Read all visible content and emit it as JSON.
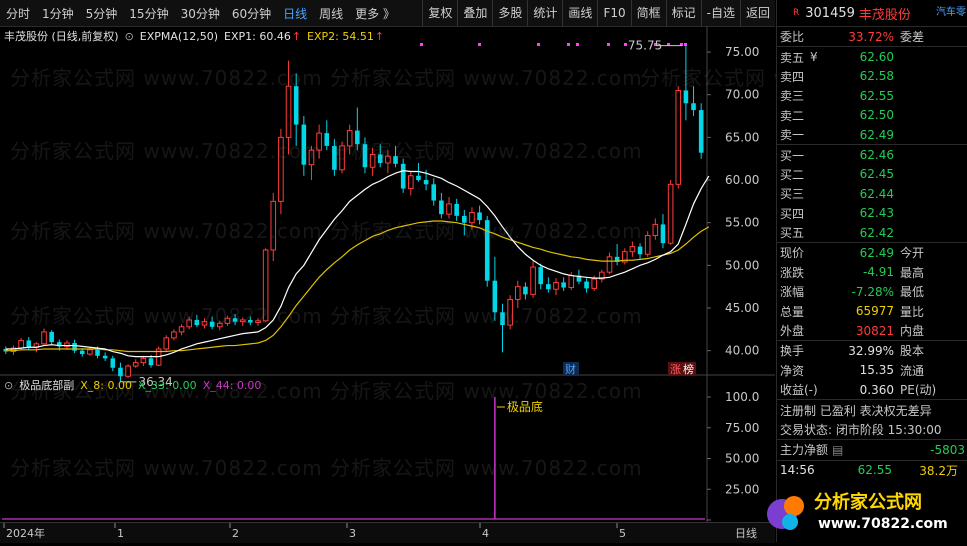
{
  "toolbar": {
    "periods": [
      "分时",
      "1分钟",
      "5分钟",
      "15分钟",
      "30分钟",
      "60分钟",
      "日线",
      "周线",
      "更多 》"
    ],
    "active_period": "日线",
    "buttons": [
      "复权",
      "叠加",
      "多股",
      "统计",
      "画线",
      "F10",
      "简框",
      "标记",
      "-自选",
      "返回"
    ]
  },
  "main_legend": {
    "title": "丰茂股份 (日线,前复权)",
    "indicator": "EXPMA(12,50)",
    "exp1_label": "EXP1: 60.46",
    "exp1_arrow": "↑",
    "exp2_label": "EXP2: 54.51",
    "exp2_arrow": "↑"
  },
  "sub_legend": {
    "title": "极品底部副",
    "x8": "X_8: 0.00",
    "x33": "X_33: 0.00",
    "x44": "X_44: 0.00"
  },
  "annotations": {
    "high": "75.75",
    "low": "36.34",
    "signal": "极品底",
    "finance_tag": "财",
    "limit_tag": "涨",
    "limit_tag2": "榜"
  },
  "watermark": "分析家公式网 www.70822.com",
  "chart_data": [
    {
      "type": "candlestick",
      "title": "丰茂股份 (日线,前复权)",
      "x_axis_labels": [
        "2024年",
        "1",
        "2",
        "3",
        "4",
        "5"
      ],
      "y_ticks": [
        40,
        45,
        50,
        55,
        60,
        65,
        70,
        75
      ],
      "ylim": [
        37.5,
        77
      ],
      "series": [
        {
          "name": "EXP1",
          "color": "#ffffff"
        },
        {
          "name": "EXP2",
          "color": "#e0c000"
        }
      ],
      "exp1_last": 60.46,
      "exp2_last": 54.51,
      "high_point": 75.75,
      "low_point": 36.34,
      "candles": [
        [
          40.2,
          40.5,
          39.6,
          39.9
        ],
        [
          39.9,
          40.6,
          39.5,
          40.3
        ],
        [
          40.3,
          41.5,
          40.0,
          41.2
        ],
        [
          41.2,
          41.6,
          40.1,
          40.4
        ],
        [
          40.4,
          41.0,
          39.8,
          40.8
        ],
        [
          40.8,
          42.6,
          40.6,
          42.2
        ],
        [
          42.2,
          42.4,
          40.6,
          41.0
        ],
        [
          41.0,
          41.3,
          40.0,
          40.5
        ],
        [
          40.5,
          41.2,
          40.1,
          40.9
        ],
        [
          40.9,
          41.3,
          39.7,
          40.0
        ],
        [
          40.0,
          40.3,
          39.3,
          39.6
        ],
        [
          39.6,
          40.4,
          39.4,
          40.1
        ],
        [
          40.1,
          40.5,
          39.1,
          39.4
        ],
        [
          39.4,
          39.8,
          38.8,
          39.1
        ],
        [
          39.1,
          39.4,
          37.6,
          38.0
        ],
        [
          38.0,
          38.6,
          36.34,
          37.0
        ],
        [
          37.0,
          38.4,
          36.8,
          38.2
        ],
        [
          38.2,
          39.0,
          38.0,
          38.6
        ],
        [
          38.6,
          39.4,
          38.2,
          39.1
        ],
        [
          39.1,
          39.5,
          38.0,
          38.3
        ],
        [
          38.3,
          40.5,
          38.2,
          40.2
        ],
        [
          40.2,
          41.8,
          40.0,
          41.5
        ],
        [
          41.5,
          42.5,
          41.2,
          42.2
        ],
        [
          42.2,
          43.1,
          41.8,
          42.8
        ],
        [
          42.8,
          44.0,
          42.5,
          43.6
        ],
        [
          43.6,
          44.2,
          42.8,
          43.0
        ],
        [
          43.0,
          43.8,
          42.6,
          43.4
        ],
        [
          43.4,
          44.0,
          42.5,
          42.8
        ],
        [
          42.8,
          43.5,
          42.4,
          43.2
        ],
        [
          43.2,
          44.1,
          42.9,
          43.8
        ],
        [
          43.8,
          44.3,
          43.0,
          43.4
        ],
        [
          43.4,
          43.9,
          42.9,
          43.6
        ],
        [
          43.6,
          44.0,
          43.0,
          43.3
        ],
        [
          43.3,
          43.8,
          42.9,
          43.5
        ],
        [
          43.5,
          52.0,
          43.4,
          51.8
        ],
        [
          51.8,
          58.5,
          50.5,
          57.5
        ],
        [
          57.5,
          66.0,
          56.0,
          65.0
        ],
        [
          65.0,
          74.0,
          63.0,
          71.0
        ],
        [
          71.0,
          72.5,
          64.0,
          66.5
        ],
        [
          66.5,
          67.5,
          60.5,
          61.8
        ],
        [
          61.8,
          64.0,
          60.0,
          63.5
        ],
        [
          63.5,
          66.5,
          62.5,
          65.5
        ],
        [
          65.5,
          67.0,
          63.5,
          64.0
        ],
        [
          64.0,
          64.8,
          60.5,
          61.2
        ],
        [
          61.2,
          64.5,
          60.8,
          64.0
        ],
        [
          64.0,
          66.5,
          63.0,
          65.8
        ],
        [
          65.8,
          68.5,
          63.5,
          64.2
        ],
        [
          64.2,
          65.0,
          60.8,
          61.5
        ],
        [
          61.5,
          63.8,
          60.5,
          63.0
        ],
        [
          63.0,
          64.2,
          61.5,
          62.0
        ],
        [
          62.0,
          63.5,
          60.8,
          62.8
        ],
        [
          62.8,
          64.0,
          61.5,
          61.9
        ],
        [
          61.9,
          62.5,
          58.5,
          59.0
        ],
        [
          59.0,
          61.0,
          58.2,
          60.5
        ],
        [
          60.5,
          62.0,
          59.8,
          60.0
        ],
        [
          60.0,
          61.2,
          58.8,
          59.5
        ],
        [
          59.5,
          60.2,
          57.0,
          57.6
        ],
        [
          57.6,
          58.5,
          55.5,
          56.0
        ],
        [
          56.0,
          58.0,
          55.5,
          57.2
        ],
        [
          57.2,
          57.8,
          55.2,
          55.8
        ],
        [
          55.8,
          56.5,
          53.5,
          55.0
        ],
        [
          55.0,
          56.8,
          54.2,
          56.2
        ],
        [
          56.2,
          57.0,
          54.8,
          55.3
        ],
        [
          55.3,
          55.8,
          47.5,
          48.2
        ],
        [
          48.2,
          51.0,
          43.5,
          44.5
        ],
        [
          44.5,
          45.5,
          39.8,
          43.0
        ],
        [
          43.0,
          46.5,
          42.5,
          46.0
        ],
        [
          46.0,
          48.2,
          45.0,
          47.5
        ],
        [
          47.5,
          48.0,
          46.0,
          46.6
        ],
        [
          46.6,
          50.5,
          46.2,
          49.8
        ],
        [
          49.8,
          50.2,
          47.2,
          47.8
        ],
        [
          47.8,
          48.6,
          46.8,
          47.2
        ],
        [
          47.2,
          48.5,
          46.5,
          48.0
        ],
        [
          48.0,
          48.6,
          47.0,
          47.4
        ],
        [
          47.4,
          49.2,
          47.1,
          48.8
        ],
        [
          48.8,
          49.5,
          47.8,
          48.1
        ],
        [
          48.1,
          48.5,
          46.8,
          47.3
        ],
        [
          47.3,
          48.8,
          47.0,
          48.4
        ],
        [
          48.4,
          49.5,
          48.0,
          49.2
        ],
        [
          49.2,
          51.5,
          49.0,
          51.0
        ],
        [
          51.0,
          52.5,
          50.0,
          50.4
        ],
        [
          50.4,
          52.0,
          50.1,
          51.6
        ],
        [
          51.6,
          52.8,
          51.0,
          52.2
        ],
        [
          52.2,
          52.6,
          50.8,
          51.3
        ],
        [
          51.3,
          54.0,
          51.0,
          53.5
        ],
        [
          53.5,
          55.5,
          53.0,
          54.8
        ],
        [
          54.8,
          56.0,
          52.0,
          52.6
        ],
        [
          52.6,
          60.0,
          52.4,
          59.5
        ],
        [
          59.5,
          71.0,
          59.0,
          70.5
        ],
        [
          70.5,
          75.75,
          67.0,
          69.0
        ],
        [
          69.0,
          71.0,
          67.5,
          68.2
        ],
        [
          68.2,
          69.0,
          62.5,
          63.2
        ]
      ],
      "exp1": [
        40.2,
        40.2,
        40.3,
        40.4,
        40.4,
        40.6,
        40.7,
        40.6,
        40.6,
        40.6,
        40.5,
        40.4,
        40.3,
        40.2,
        39.9,
        39.7,
        39.4,
        39.3,
        39.3,
        39.3,
        39.3,
        39.5,
        39.8,
        40.2,
        40.5,
        40.8,
        41.0,
        41.2,
        41.4,
        41.6,
        41.8,
        42.0,
        42.1,
        42.2,
        42.7,
        43.6,
        45.2,
        47.4,
        49.0,
        50.0,
        51.5,
        53.0,
        54.2,
        55.4,
        56.4,
        57.5,
        58.2,
        58.9,
        59.5,
        59.9,
        60.4,
        60.8,
        61.1,
        61.0,
        61.0,
        60.8,
        60.5,
        60.2,
        59.7,
        59.3,
        58.8,
        58.3,
        57.8,
        56.9,
        55.8,
        54.5,
        53.3,
        52.2,
        51.3,
        50.6,
        50.0,
        49.6,
        49.3,
        49.0,
        48.8,
        48.7,
        48.6,
        48.5,
        48.5,
        48.6,
        48.9,
        49.2,
        49.6,
        50.0,
        50.3,
        50.7,
        51.2,
        51.6,
        52.5,
        54.8,
        57.2,
        59.0,
        60.46
      ],
      "exp2": [
        40.0,
        40.0,
        40.1,
        40.1,
        40.1,
        40.2,
        40.2,
        40.2,
        40.2,
        40.2,
        40.2,
        40.2,
        40.2,
        40.1,
        40.1,
        40.0,
        39.9,
        39.9,
        39.9,
        39.9,
        39.9,
        39.9,
        40.0,
        40.0,
        40.1,
        40.2,
        40.3,
        40.4,
        40.5,
        40.6,
        40.6,
        40.7,
        40.8,
        40.9,
        41.2,
        41.8,
        42.8,
        44.0,
        45.3,
        46.4,
        47.5,
        48.6,
        49.5,
        50.3,
        51.0,
        51.8,
        52.4,
        52.9,
        53.4,
        53.7,
        54.1,
        54.4,
        54.6,
        54.8,
        55.0,
        55.1,
        55.2,
        55.2,
        55.1,
        55.0,
        54.8,
        54.6,
        54.4,
        54.0,
        53.7,
        53.3,
        53.0,
        52.7,
        52.4,
        52.1,
        51.9,
        51.6,
        51.4,
        51.2,
        51.0,
        50.9,
        50.7,
        50.6,
        50.5,
        50.5,
        50.5,
        50.6,
        50.6,
        50.7,
        50.8,
        51.0,
        51.2,
        51.4,
        51.8,
        52.5,
        53.3,
        54.0,
        54.51
      ]
    },
    {
      "type": "line",
      "title": "极品底部副",
      "y_ticks": [
        0,
        25,
        50,
        75,
        100
      ],
      "ylim": [
        0,
        100
      ],
      "spike_index": 64,
      "spike_value": 100,
      "series": [
        {
          "name": "X_8",
          "color": "#f0d000",
          "last": 0
        },
        {
          "name": "X_33",
          "color": "#22cc55",
          "last": 0
        },
        {
          "name": "X_44",
          "color": "#cc33cc",
          "last": 0
        }
      ]
    }
  ],
  "y_labels_main": [
    "75.00",
    "70.00",
    "65.00",
    "60.00",
    "55.00",
    "50.00",
    "45.00",
    "40.00"
  ],
  "y_labels_sub": [
    "100.0",
    "75.00",
    "50.00",
    "25.00",
    "0.00"
  ],
  "bottom_right_tag": "日线",
  "side": {
    "code": "301459",
    "name": "丰茂股份",
    "tag": "汽车零",
    "wei_bi_label": "委比",
    "wei_bi": "33.72%",
    "wei_cha_label": "委差",
    "asks": [
      {
        "label": "卖五",
        "extra": "¥",
        "price": "62.60"
      },
      {
        "label": "卖四",
        "extra": "",
        "price": "62.58"
      },
      {
        "label": "卖三",
        "extra": "",
        "price": "62.55"
      },
      {
        "label": "卖二",
        "extra": "",
        "price": "62.50"
      },
      {
        "label": "卖一",
        "extra": "",
        "price": "62.49"
      }
    ],
    "bids": [
      {
        "label": "买一",
        "price": "62.46"
      },
      {
        "label": "买二",
        "price": "62.45"
      },
      {
        "label": "买三",
        "price": "62.44"
      },
      {
        "label": "买四",
        "price": "62.43"
      },
      {
        "label": "买五",
        "price": "62.42"
      }
    ],
    "stats": [
      {
        "l": "现价",
        "v": "62.49",
        "vc": "green",
        "r": "今开"
      },
      {
        "l": "涨跌",
        "v": "-4.91",
        "vc": "green",
        "r": "最高"
      },
      {
        "l": "涨幅",
        "v": "-7.28%",
        "vc": "green",
        "r": "最低"
      },
      {
        "l": "总量",
        "v": "65977",
        "vc": "yellow",
        "r": "量比"
      },
      {
        "l": "外盘",
        "v": "30821",
        "vc": "red",
        "r": "内盘"
      }
    ],
    "stats2": [
      {
        "l": "换手",
        "v": "32.99%",
        "r": "股本"
      },
      {
        "l": "净资",
        "v": "15.35",
        "r": "流通"
      },
      {
        "l": "收益(-)",
        "v": "0.360",
        "r": "PE(动)"
      }
    ],
    "tags_line": "注册制 已盈利 表决权无差异",
    "trade_status": "交易状态: 闭市阶段 15:30:00",
    "main_net_label": "主力净额",
    "main_net_value": "-5803",
    "tick_time": "14:56",
    "tick_price": "62.55",
    "tick_vol": "38.2万"
  },
  "logo": {
    "text": "分析家公式网",
    "url": "www.70822.com"
  }
}
